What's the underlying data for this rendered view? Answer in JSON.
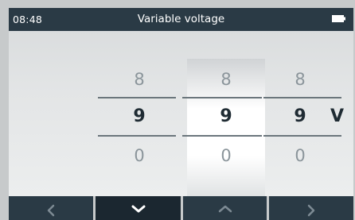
{
  "status_bar": {
    "time": "08:48",
    "title": "Variable voltage",
    "battery_icon": "battery-icon"
  },
  "digit_columns": [
    {
      "above": "8",
      "selected": "9",
      "below": "0"
    },
    {
      "above": "8",
      "selected": "9",
      "below": "0"
    },
    {
      "above": "8",
      "selected": "9",
      "below": "0"
    }
  ],
  "unit": "V",
  "nav_buttons": [
    {
      "icon": "chevron-left-icon"
    },
    {
      "icon": "chevron-down-icon"
    },
    {
      "icon": "chevron-up-icon"
    },
    {
      "icon": "chevron-right-icon"
    }
  ],
  "colors": {
    "bar_dark": "#2a3a45",
    "active_button": "#1b2730",
    "selected_text": "#1f2b33",
    "dim_text": "#8b959b"
  }
}
